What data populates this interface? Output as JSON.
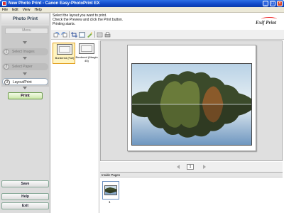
{
  "window": {
    "title": "New Photo Print - Canon Easy-PhotoPrint EX",
    "controls": {
      "minimize": "_",
      "maximize": "□",
      "close": "×"
    }
  },
  "menu": [
    "File",
    "Edit",
    "View",
    "Help"
  ],
  "sidebar": {
    "heading": "Photo Print",
    "menu_button": "Menu",
    "steps": [
      {
        "num": "1",
        "label": "Select Images",
        "active": false
      },
      {
        "num": "2",
        "label": "Select Paper",
        "active": false
      },
      {
        "num": "3",
        "label": "Layout/Print",
        "active": true
      }
    ],
    "print_button": "Print",
    "save_button": "Save",
    "help_button": "Help",
    "exit_button": "Exit"
  },
  "instructions": [
    "Select the layout you want to print.",
    "Check the Preview and click the Print button.",
    "Printing starts."
  ],
  "brand": {
    "logo_text": "Exif Print"
  },
  "toolbar_icons": [
    "rotate-left-icon",
    "rotate-right-icon",
    "crop-icon",
    "frame-icon",
    "correct-icon",
    "filter-icon",
    "settings-icon"
  ],
  "layouts": [
    {
      "label": "Bordered (Full)",
      "selected": true
    },
    {
      "label": "Bordered (Margin 45)",
      "selected": false
    }
  ],
  "preview": {
    "current_page": "1"
  },
  "inside_pages": {
    "heading": "Inside Pages",
    "pages": [
      "1"
    ]
  },
  "colors": {
    "title_blue": "#1048c8",
    "sidebar_bg": "#dcdcdc",
    "print_green": "#cbe6a8",
    "selected_layout": "#e2a020"
  }
}
